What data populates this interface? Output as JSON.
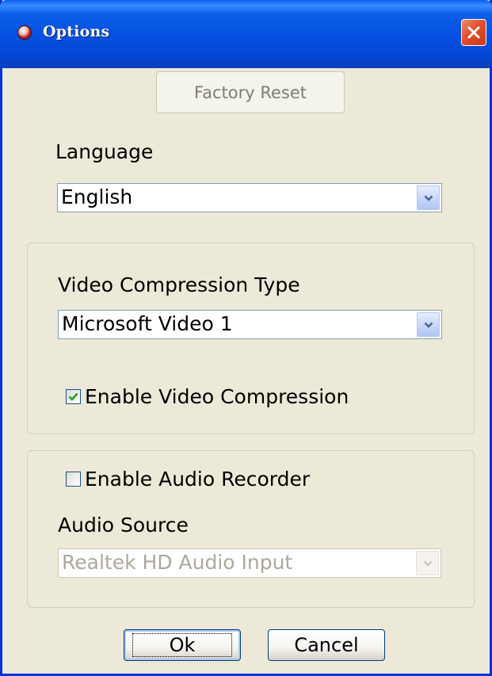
{
  "window": {
    "title": "Options",
    "app_icon": "app-ladybug-icon",
    "close_icon": "close-icon",
    "close_color": "#e0502e",
    "titlebar_color": "#0550e0"
  },
  "factory_reset": {
    "label": "Factory Reset",
    "enabled": false
  },
  "language": {
    "label": "Language",
    "selected": "English"
  },
  "video": {
    "compression_type_label": "Video Compression Type",
    "compression_type_selected": "Microsoft Video 1",
    "enable_compression_label": "Enable Video Compression",
    "enable_compression_checked": true
  },
  "audio": {
    "enable_recorder_label": "Enable Audio Recorder",
    "enable_recorder_checked": false,
    "source_label": "Audio Source",
    "source_selected": "Realtek HD Audio Input",
    "source_enabled": false
  },
  "buttons": {
    "ok_label": "Ok",
    "cancel_label": "Cancel"
  }
}
